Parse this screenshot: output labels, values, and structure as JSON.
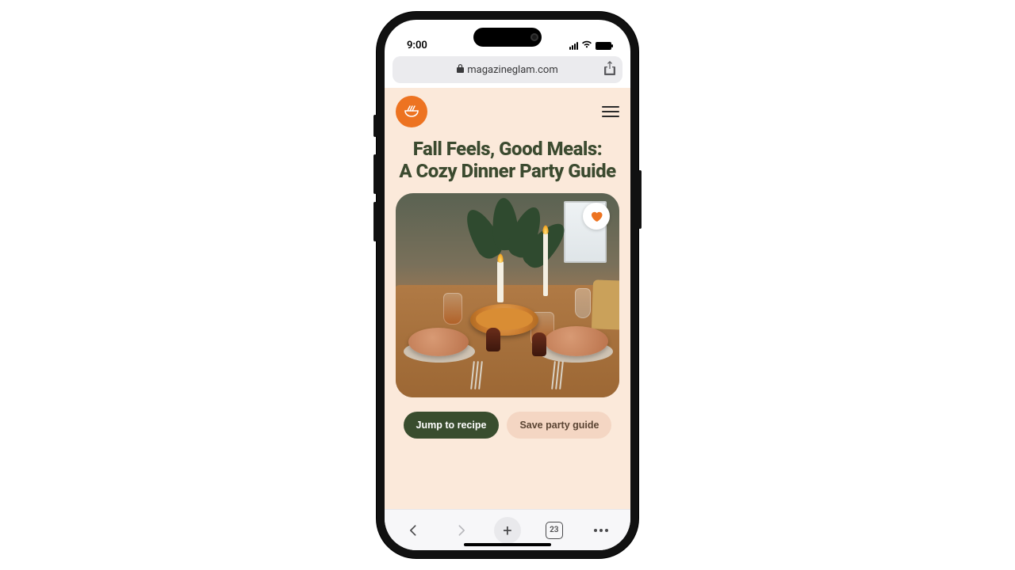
{
  "status": {
    "time": "9:00"
  },
  "browser": {
    "domain": "magazineglam.com",
    "tab_count": "23"
  },
  "article": {
    "title_line1": "Fall Feels, Good Meals:",
    "title_line2": "A Cozy Dinner Party Guide"
  },
  "cta": {
    "primary": "Jump to recipe",
    "secondary": "Save party guide"
  },
  "colors": {
    "accent": "#ed7321",
    "page_bg": "#fbe9da",
    "title": "#3b4a2f",
    "primary_btn": "#394d2e"
  },
  "icons": {
    "logo": "bowl-whisk-icon",
    "favorite": "heart-icon",
    "menu": "hamburger-icon",
    "share": "share-icon",
    "lock": "lock-icon"
  }
}
